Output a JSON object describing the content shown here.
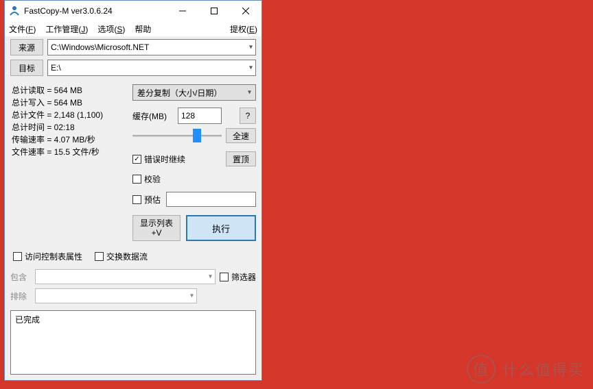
{
  "window": {
    "title": "FastCopy-M ver3.0.6.24"
  },
  "menu": {
    "file": "文件(",
    "file_u": "F",
    "file_end": ")",
    "job": "工作管理(",
    "job_u": "J",
    "job_end": ")",
    "option": "选项(",
    "option_u": "S",
    "option_end": ")",
    "help": "帮助",
    "auth": "提权(",
    "auth_u": "E",
    "auth_end": ")"
  },
  "paths": {
    "source_btn": "来源",
    "source_value": "C:\\Windows\\Microsoft.NET",
    "dest_btn": "目标",
    "dest_value": "E:\\"
  },
  "stats": {
    "read": "总计读取 = 564 MB",
    "write": "总计写入 = 564 MB",
    "files": "总计文件 = 2,148 (1,100)",
    "time": "总计时间 = 02:18",
    "rate": "传输速率 = 4.07 MB/秒",
    "frate": "文件速率 = 15.5 文件/秒"
  },
  "controls": {
    "mode": "差分复制（大小/日期）",
    "cache_label": "缓存(MB)",
    "cache_value": "128",
    "help": "?",
    "fullspeed": "全速",
    "cont_on_error": "错误时继续",
    "ontop": "置顶",
    "verify": "校验",
    "estimate": "预估",
    "show_list": "显示列表\n+V",
    "execute": "执行"
  },
  "lower": {
    "acl": "访问控制表属性",
    "ads": "交换数据流",
    "include": "包含",
    "exclude": "排除",
    "filter": "筛选器"
  },
  "log": "已完成",
  "watermark": "什么值得买"
}
